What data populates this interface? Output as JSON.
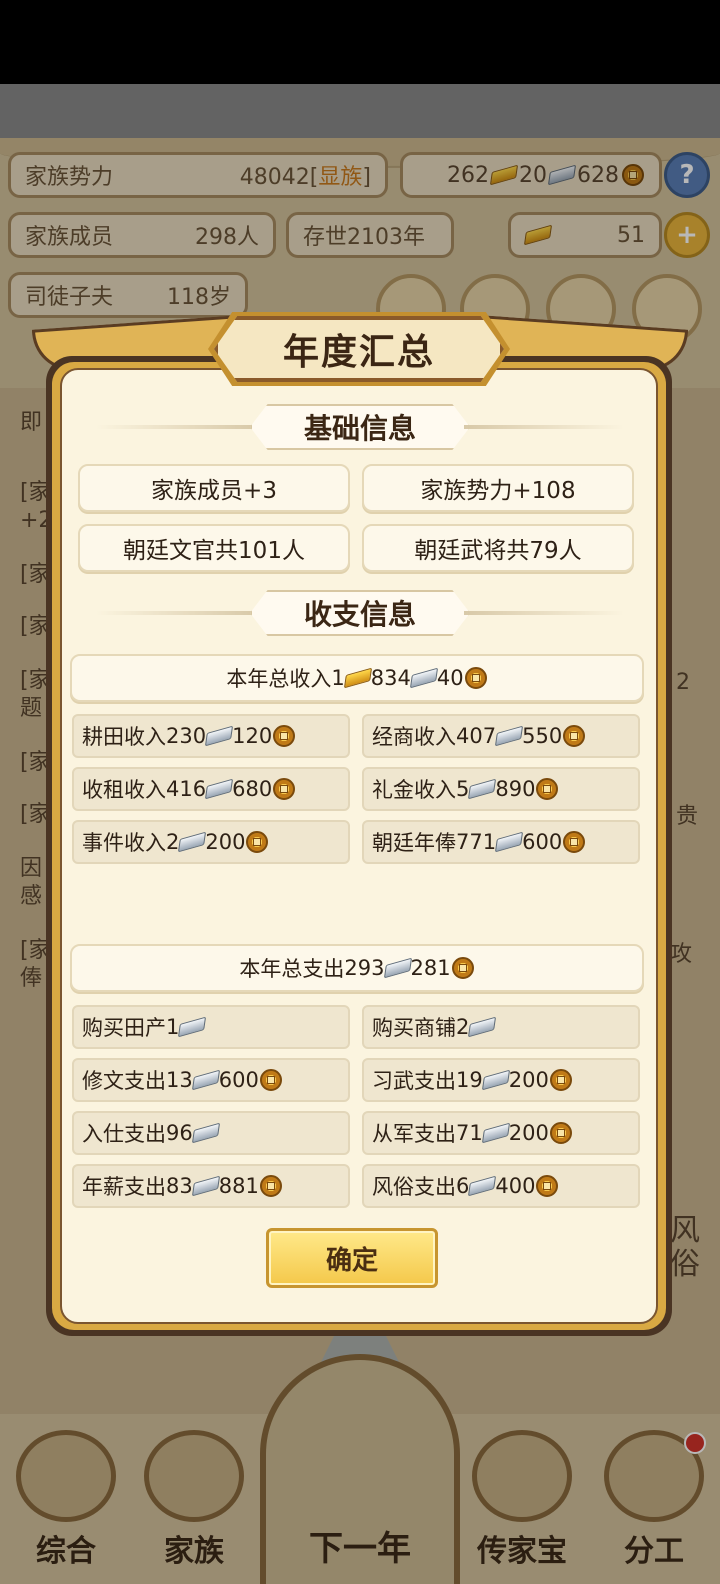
{
  "background": {
    "power": {
      "label": "家族势力",
      "value": "48042",
      "rank_open": "[",
      "rank": "显族",
      "rank_close": "]"
    },
    "resources": {
      "gold": "262",
      "silver": "20",
      "coins": "628"
    },
    "members": {
      "label": "家族成员",
      "value": "298人"
    },
    "existed": "存世2103年",
    "ingot": "51",
    "patriarch": {
      "name": "司徒子夫",
      "age": "118岁"
    },
    "list_fragments": [
      "即",
      "[家",
      "+2",
      "[家",
      "[家",
      "[家",
      "题",
      "[家",
      "[家",
      "因",
      "感",
      "[家",
      "俸"
    ],
    "right_fragments": [
      "2",
      "贵",
      "攻"
    ],
    "side_fragments": [
      "风",
      "俗"
    ],
    "help_glyph": "?",
    "plus_glyph": "+"
  },
  "modal": {
    "title": "年度汇总",
    "basic": {
      "heading": "基础信息",
      "items": [
        "家族成员+3",
        "家族势力+108",
        "朝廷文官共101人",
        "朝廷武将共79人"
      ]
    },
    "finance": {
      "heading": "收支信息",
      "income_total": {
        "label": "本年总收入 ",
        "gold": "1",
        "silver": "834",
        "coins": "40"
      },
      "income_items": [
        {
          "label": "耕田收入",
          "silver": "230",
          "coins": "120"
        },
        {
          "label": "经商收入",
          "silver": "407",
          "coins": "550"
        },
        {
          "label": "收租收入",
          "silver": "416",
          "coins": "680"
        },
        {
          "label": "礼金收入",
          "silver": "5",
          "coins": "890"
        },
        {
          "label": "事件收入",
          "silver": "2",
          "coins": "200"
        },
        {
          "label": "朝廷年俸",
          "silver": "771",
          "coins": "600"
        }
      ],
      "expense_total": {
        "label": "本年总支出",
        "silver": "293",
        "coins": "281"
      },
      "expense_items": [
        {
          "label": "购买田产",
          "silver": "1",
          "coins": null
        },
        {
          "label": "购买商铺",
          "silver": "2",
          "coins": null
        },
        {
          "label": "修文支出",
          "silver": "13",
          "coins": "600"
        },
        {
          "label": "习武支出",
          "silver": "19",
          "coins": "200"
        },
        {
          "label": "入仕支出",
          "silver": "96",
          "coins": null
        },
        {
          "label": "从军支出",
          "silver": "71",
          "coins": "200"
        },
        {
          "label": "年薪支出",
          "silver": "83",
          "coins": "881"
        },
        {
          "label": "风俗支出",
          "silver": "6",
          "coins": "400"
        }
      ]
    },
    "confirm_label": "确定"
  },
  "bottom_nav": [
    {
      "label": "综合"
    },
    {
      "label": "家族"
    },
    {
      "label": "下一年"
    },
    {
      "label": "传家宝"
    },
    {
      "label": "分工"
    }
  ],
  "colors": {
    "gold_frame": "#d9a943",
    "parchment": "#fbf4df",
    "accent_rank": "#c97a1e",
    "confirm": "#f4c84a"
  }
}
